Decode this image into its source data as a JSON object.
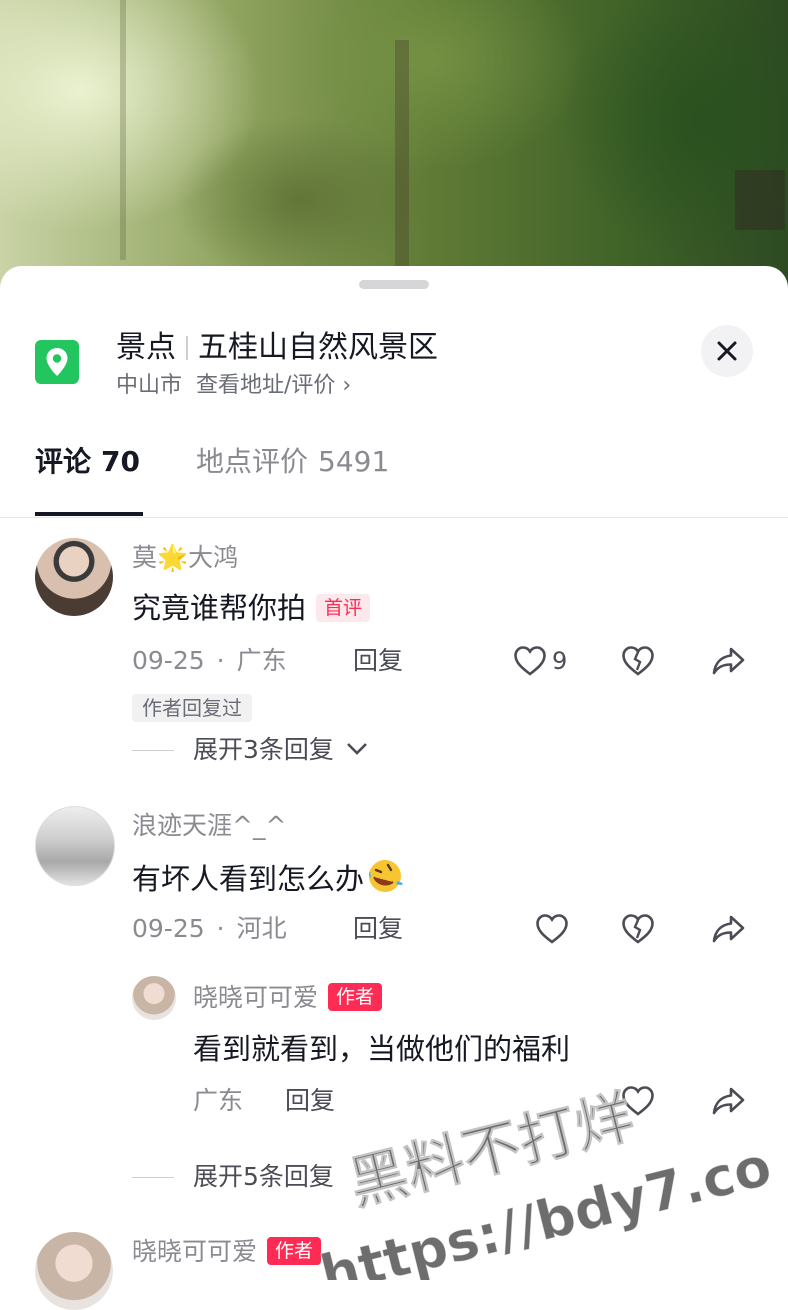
{
  "location": {
    "category": "景点",
    "name": "五桂山自然风景区",
    "city": "中山市",
    "address_link": "查看地址/评价 ›"
  },
  "tabs": [
    {
      "label": "评论",
      "count": "70",
      "active": true
    },
    {
      "label": "地点评价",
      "count": "5491",
      "active": false
    }
  ],
  "comments": [
    {
      "username": "莫🌟大鸿",
      "text": "究竟谁帮你拍",
      "badge": "首评",
      "date": "09-25",
      "region": "广东",
      "reply_label": "回复",
      "likes": "9",
      "author_replied": "作者回复过",
      "expand": "展开3条回复"
    },
    {
      "username": "浪迹天涯^_^",
      "text": "有坏人看到怎么办",
      "emoji": "rofl-emoji",
      "date": "09-25",
      "region": "河北",
      "reply_label": "回复",
      "replies": [
        {
          "username": "晓晓可可爱",
          "badge": "作者",
          "text": "看到就看到，当做他们的福利",
          "region": "广东",
          "reply_label": "回复"
        }
      ],
      "expand": "展开5条回复"
    },
    {
      "username": "晓晓可可爱",
      "badge": "作者"
    }
  ],
  "watermark": {
    "line1": "黑料不打烊",
    "line2": "https://bdy7.co"
  },
  "colors": {
    "accent": "#fe2c55",
    "location_icon": "#22c55e"
  }
}
